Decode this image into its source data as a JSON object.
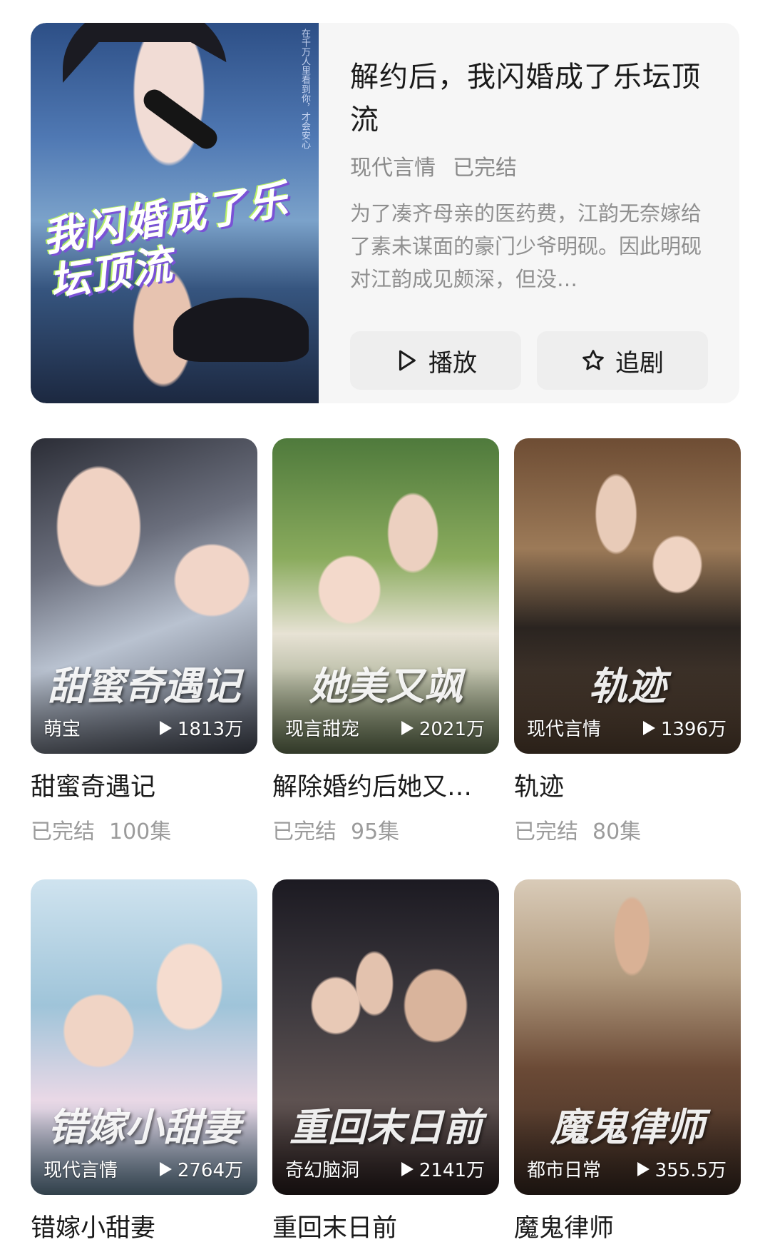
{
  "featured": {
    "title": "解约后，我闪婚成了乐坛顶流",
    "poster_title": "我闪婚成了乐坛顶流",
    "poster_side_text": "在千万人里看到你，才会安心",
    "tags": [
      "现代言情",
      "已完结"
    ],
    "description": "为了凑齐母亲的医药费，江韵无奈嫁给了素未谋面的豪门少爷明砚。因此明砚对江韵成见颇深，但没…",
    "play_label": "播放",
    "follow_label": "追剧"
  },
  "grid": [
    {
      "title": "甜蜜奇遇记",
      "poster_title": "甜蜜奇遇记",
      "genre": "萌宝",
      "plays": "1813万",
      "status": "已完结",
      "episodes": "100集"
    },
    {
      "title": "解除婚约后她又…",
      "poster_title": "她美又飒",
      "genre": "现言甜宠",
      "plays": "2021万",
      "status": "已完结",
      "episodes": "95集"
    },
    {
      "title": "轨迹",
      "poster_title": "轨迹",
      "genre": "现代言情",
      "plays": "1396万",
      "status": "已完结",
      "episodes": "80集"
    },
    {
      "title": "错嫁小甜妻",
      "poster_title": "错嫁小甜妻",
      "genre": "现代言情",
      "plays": "2764万"
    },
    {
      "title": "重回末日前",
      "poster_title": "重回末日前",
      "genre": "奇幻脑洞",
      "plays": "2141万"
    },
    {
      "title": "魔鬼律师",
      "poster_title": "魔鬼律师",
      "genre": "都市日常",
      "plays": "355.5万"
    }
  ],
  "icons": {
    "play": "play-icon",
    "star": "star-icon",
    "play_count": "play-count-icon"
  }
}
